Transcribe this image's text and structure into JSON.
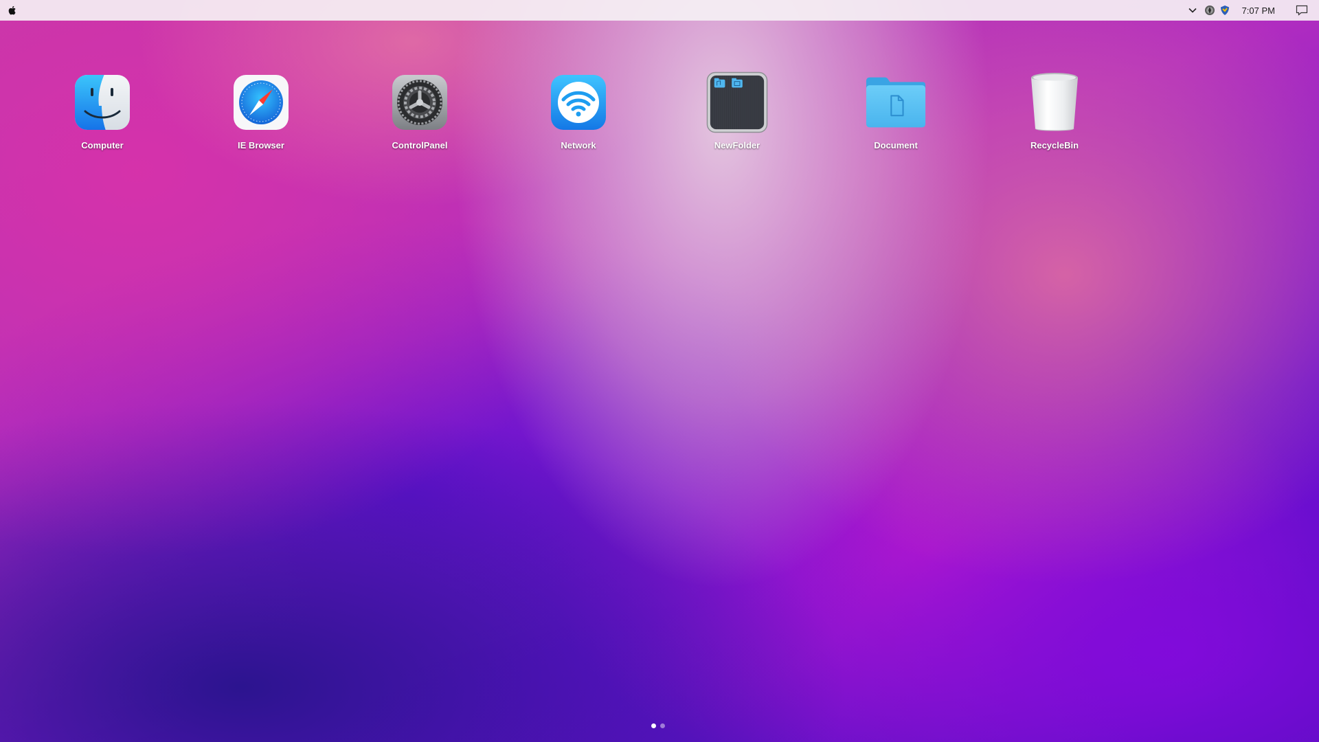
{
  "menubar": {
    "clock": "7:07 PM",
    "tray_icons": [
      "chevron-down-icon",
      "globe-status-icon",
      "shield-status-icon"
    ],
    "notification_icon": "notification-icon"
  },
  "desktop_icons": [
    {
      "label": "Computer",
      "icon": "finder-icon"
    },
    {
      "label": "IE Browser",
      "icon": "compass-browser-icon"
    },
    {
      "label": "ControlPanel",
      "icon": "gear-icon"
    },
    {
      "label": "Network",
      "icon": "wifi-icon"
    },
    {
      "label": "NewFolder",
      "icon": "folder-stack-icon"
    },
    {
      "label": "Document",
      "icon": "document-folder-icon"
    },
    {
      "label": "RecycleBin",
      "icon": "trash-icon"
    }
  ],
  "pagination": {
    "pages": 2,
    "current": 1
  }
}
